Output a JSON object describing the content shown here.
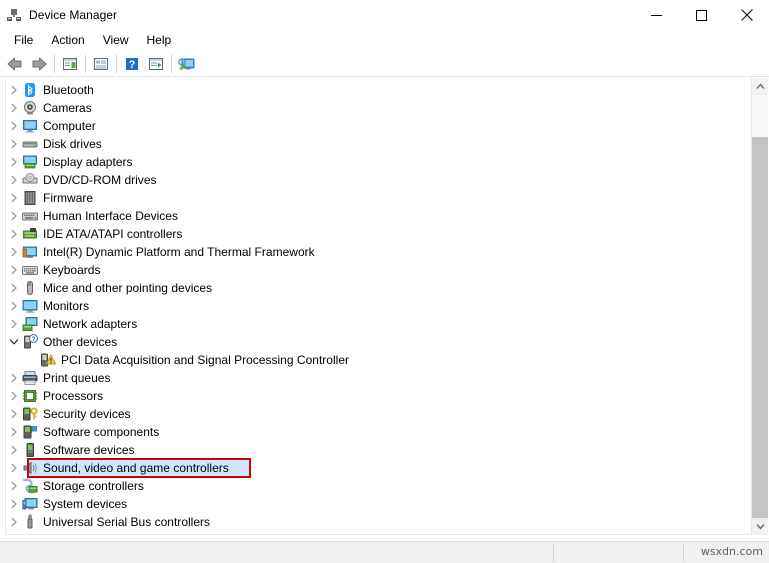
{
  "window": {
    "title": "Device Manager",
    "app_icon": "device-manager-icon",
    "controls": {
      "minimize": "minimize-button",
      "maximize": "maximize-button",
      "close": "close-button"
    }
  },
  "menubar": {
    "items": [
      {
        "label": "File"
      },
      {
        "label": "Action"
      },
      {
        "label": "View"
      },
      {
        "label": "Help"
      }
    ]
  },
  "toolbar": {
    "buttons": [
      {
        "icon": "back-arrow-icon",
        "title": "Back"
      },
      {
        "icon": "forward-arrow-icon",
        "title": "Forward"
      },
      {
        "icon": "show-hide-console-tree-icon",
        "title": "Show/Hide console tree"
      },
      {
        "icon": "properties-icon",
        "title": "Properties"
      },
      {
        "icon": "help-icon",
        "title": "Help"
      },
      {
        "icon": "update-driver-icon",
        "title": "Update driver"
      },
      {
        "icon": "scan-hardware-changes-icon",
        "title": "Scan for hardware changes"
      }
    ]
  },
  "tree": {
    "items": [
      {
        "label": "Bluetooth",
        "icon": "bluetooth-icon",
        "expandable": true,
        "expanded": false,
        "level": 0,
        "selected": false
      },
      {
        "label": "Cameras",
        "icon": "camera-icon",
        "expandable": true,
        "expanded": false,
        "level": 0,
        "selected": false
      },
      {
        "label": "Computer",
        "icon": "computer-icon",
        "expandable": true,
        "expanded": false,
        "level": 0,
        "selected": false
      },
      {
        "label": "Disk drives",
        "icon": "disk-drive-icon",
        "expandable": true,
        "expanded": false,
        "level": 0,
        "selected": false
      },
      {
        "label": "Display adapters",
        "icon": "display-adapter-icon",
        "expandable": true,
        "expanded": false,
        "level": 0,
        "selected": false
      },
      {
        "label": "DVD/CD-ROM drives",
        "icon": "dvd-drive-icon",
        "expandable": true,
        "expanded": false,
        "level": 0,
        "selected": false
      },
      {
        "label": "Firmware",
        "icon": "firmware-icon",
        "expandable": true,
        "expanded": false,
        "level": 0,
        "selected": false
      },
      {
        "label": "Human Interface Devices",
        "icon": "hid-icon",
        "expandable": true,
        "expanded": false,
        "level": 0,
        "selected": false
      },
      {
        "label": "IDE ATA/ATAPI controllers",
        "icon": "ide-controller-icon",
        "expandable": true,
        "expanded": false,
        "level": 0,
        "selected": false
      },
      {
        "label": "Intel(R) Dynamic Platform and Thermal Framework",
        "icon": "system-device-icon",
        "expandable": true,
        "expanded": false,
        "level": 0,
        "selected": false
      },
      {
        "label": "Keyboards",
        "icon": "keyboard-icon",
        "expandable": true,
        "expanded": false,
        "level": 0,
        "selected": false
      },
      {
        "label": "Mice and other pointing devices",
        "icon": "mouse-icon",
        "expandable": true,
        "expanded": false,
        "level": 0,
        "selected": false
      },
      {
        "label": "Monitors",
        "icon": "monitor-icon",
        "expandable": true,
        "expanded": false,
        "level": 0,
        "selected": false
      },
      {
        "label": "Network adapters",
        "icon": "network-adapter-icon",
        "expandable": true,
        "expanded": false,
        "level": 0,
        "selected": false
      },
      {
        "label": "Other devices",
        "icon": "other-device-icon",
        "expandable": true,
        "expanded": true,
        "level": 0,
        "selected": false
      },
      {
        "label": "PCI Data Acquisition and Signal Processing Controller",
        "icon": "unknown-device-warning-icon",
        "expandable": false,
        "expanded": false,
        "level": 1,
        "selected": false
      },
      {
        "label": "Print queues",
        "icon": "printer-icon",
        "expandable": true,
        "expanded": false,
        "level": 0,
        "selected": false
      },
      {
        "label": "Processors",
        "icon": "processor-icon",
        "expandable": true,
        "expanded": false,
        "level": 0,
        "selected": false
      },
      {
        "label": "Security devices",
        "icon": "security-device-icon",
        "expandable": true,
        "expanded": false,
        "level": 0,
        "selected": false
      },
      {
        "label": "Software components",
        "icon": "software-component-icon",
        "expandable": true,
        "expanded": false,
        "level": 0,
        "selected": false
      },
      {
        "label": "Software devices",
        "icon": "software-device-icon",
        "expandable": true,
        "expanded": false,
        "level": 0,
        "selected": false
      },
      {
        "label": "Sound, video and game controllers",
        "icon": "sound-controller-icon",
        "expandable": true,
        "expanded": false,
        "level": 0,
        "selected": true
      },
      {
        "label": "Storage controllers",
        "icon": "storage-controller-icon",
        "expandable": true,
        "expanded": false,
        "level": 0,
        "selected": false
      },
      {
        "label": "System devices",
        "icon": "system-devices-icon",
        "expandable": true,
        "expanded": false,
        "level": 0,
        "selected": false
      },
      {
        "label": "Universal Serial Bus controllers",
        "icon": "usb-controller-icon",
        "expandable": true,
        "expanded": false,
        "level": 0,
        "selected": false
      }
    ],
    "highlight": {
      "target_label": "Sound, video and game controllers",
      "color": "#cc0000",
      "selection_color": "#cce8ff"
    }
  },
  "scrollbar": {
    "up_arrow": "scroll-up-arrow-icon",
    "down_arrow": "scroll-down-arrow-icon"
  },
  "statusbar": {
    "watermark": "wsxdn.com"
  }
}
